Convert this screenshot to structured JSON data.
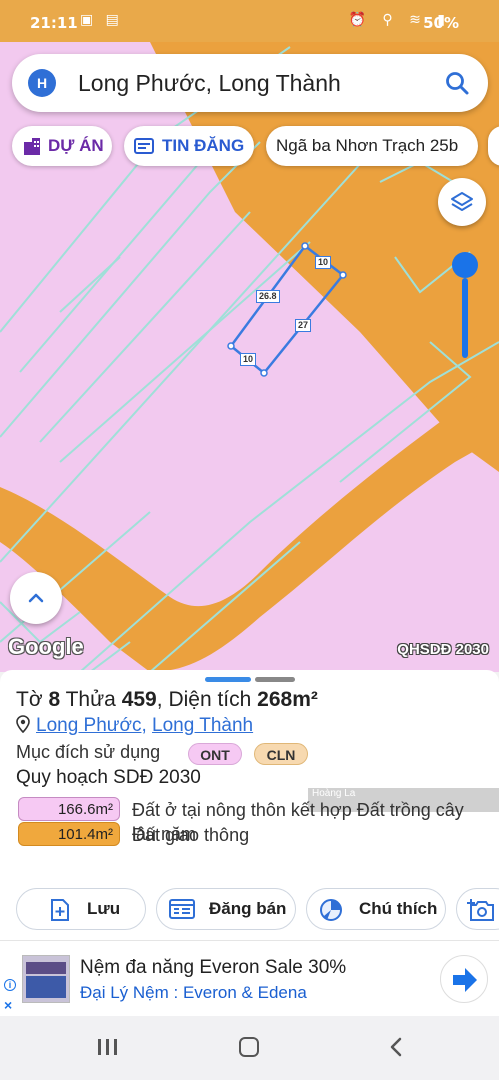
{
  "status_bar": {
    "time": "21:11",
    "battery": "50%"
  },
  "search": {
    "logo_letter": "H",
    "title": "Long Phước, Long Thành"
  },
  "chips": {
    "du_an": "DỰ ÁN",
    "tin_dang": "TIN ĐĂNG",
    "nga_ba": "Ngã ba Nhơn Trạch 25b"
  },
  "map": {
    "edge_labels": [
      "10",
      "26.8",
      "27",
      "10"
    ],
    "attribution": "Google",
    "layer_label": "QHSDĐ 2030",
    "colors": {
      "residential_pink": "#f2c9ef",
      "transport_orange": "#eba13e",
      "boundary_line": "#9fe0d8",
      "parcel_outline": "#3a7be0"
    }
  },
  "parcel": {
    "prefix_to": "Tờ",
    "to_number": "8",
    "prefix_thua": "Thửa",
    "thua_number": "459",
    "area_prefix": "Diện tích",
    "area_value": "268m²",
    "location_ward": "Long Phước",
    "location_separator": ",",
    "location_district": "Long Thành",
    "purpose_label": "Mục đích sử dụng",
    "purpose_codes": [
      "ONT",
      "CLN"
    ],
    "plan_title": "Quy hoạch SDĐ 2030",
    "watermark": "Hoàng La",
    "plan_items": [
      {
        "area": "166.6m²",
        "description": "Đất ở tại nông thôn kết hợp Đất trồng cây lâu năm"
      },
      {
        "area": "101.4m²",
        "description": "Đất giao thông"
      }
    ]
  },
  "actions": {
    "save": "Lưu",
    "post_sale": "Đăng bán",
    "legend": "Chú thích"
  },
  "ad": {
    "title": "Nệm đa năng Everon Sale 30%",
    "subtitle": "Đại Lý Nệm : Everon & Edena",
    "info_icon": "i",
    "close_icon": "×"
  }
}
